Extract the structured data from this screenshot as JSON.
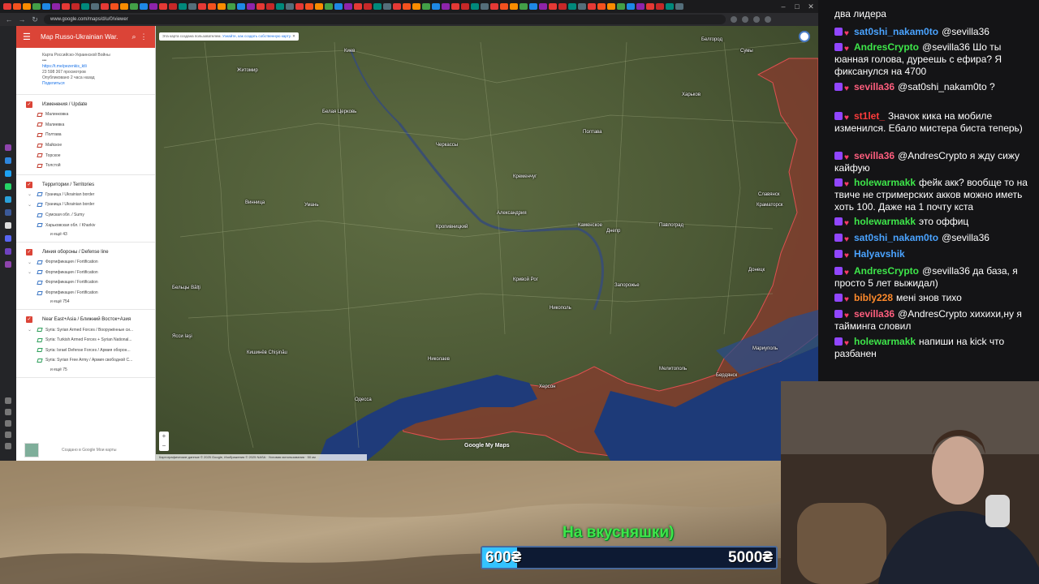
{
  "browser": {
    "url": "www.google.com/maps/d/u/0/viewer"
  },
  "map_panel": {
    "title": "Map Russo-Ukrainian War.",
    "info": {
      "line1": "Карта Российско-Украинской Войны",
      "link": "https://t.me/pezenkis_ktli",
      "views": "23 598 367 просмотров",
      "updated": "Опубликовано 2 часа назад",
      "share": "Поделиться"
    },
    "layers": [
      {
        "name": "Изменения / Update",
        "items": [
          "Малинковка",
          "Малиевка",
          "Полтава",
          "Майское",
          "Торское",
          "Толстой"
        ],
        "more": ""
      },
      {
        "name": "Территории / Territories",
        "items": [
          "Граница / Ukrainian border",
          "Граница / Ukrainian border",
          "Сумская обл. / Sumy",
          "Харьковская обл. / Kharkiv"
        ],
        "more": "и ещё 43"
      },
      {
        "name": "Линия обороны / Defense line",
        "items": [
          "Фортификация / Fortification",
          "Фортификация / Fortification",
          "Фортификация / Fortification",
          "Фортификация / Fortification"
        ],
        "more": "и ещё 754"
      },
      {
        "name": "Near East+Asia / Ближний Восток+Азия",
        "items": [
          "Syria: Syrian Armed Forces / Вооружённые си...",
          "Syria: Turkish Armed Forces + Syrian National...",
          "Syria: Israel Defense Forces / Армия оборон...",
          "Syria: Syrian Free Army / Армия свободной С..."
        ],
        "more": "и ещё 75"
      }
    ],
    "footer": "Создано в Google Мои карты"
  },
  "map": {
    "banner_text": "Эта карта создана пользователем.",
    "banner_link": "Узнайте, как создать собственную карту.",
    "google_logo": "Google My Maps",
    "attribution": "Картографические данные © 2025 Google, Изображения © 2025 NASA · Условия использования · 50 км",
    "cities": [
      {
        "name": "Киев"
      },
      {
        "name": "Житомир"
      },
      {
        "name": "Белая Церковь"
      },
      {
        "name": "Черкассы"
      },
      {
        "name": "Полтава"
      },
      {
        "name": "Харьков"
      },
      {
        "name": "Белгород"
      },
      {
        "name": "Сумы"
      },
      {
        "name": "Кременчуг"
      },
      {
        "name": "Умань"
      },
      {
        "name": "Кропивницкий"
      },
      {
        "name": "Александрия"
      },
      {
        "name": "Днепр"
      },
      {
        "name": "Каменское"
      },
      {
        "name": "Павлоград"
      },
      {
        "name": "Кривой Рог"
      },
      {
        "name": "Запорожье"
      },
      {
        "name": "Никополь"
      },
      {
        "name": "Николаев"
      },
      {
        "name": "Одесса"
      },
      {
        "name": "Кишинёв Chişinău"
      },
      {
        "name": "Бельцы Bălţi"
      },
      {
        "name": "Донецк"
      },
      {
        "name": "Краматорск"
      },
      {
        "name": "Мариуполь"
      },
      {
        "name": "Бердянск"
      },
      {
        "name": "Мелитополь"
      },
      {
        "name": "Херсон"
      },
      {
        "name": "Славянск"
      },
      {
        "name": "Винница"
      },
      {
        "name": "Ясси Iaşi"
      }
    ]
  },
  "chat": {
    "top_line": "два лидера",
    "messages": [
      {
        "user": "sat0shi_nakam0to",
        "color": "#4aa3ff",
        "text": "@sevilla36"
      },
      {
        "user": "AndresCrypto",
        "color": "#3ee64a",
        "text": "@sevilla36 Шо ты юанная голова, дуреешь с ефира? Я фиксанулся на 4700"
      },
      {
        "user": "sevilla36",
        "color": "#ff5e7e",
        "text": "@sat0shi_nakam0to ?"
      },
      {
        "user": "st1let_",
        "color": "#ff3b3b",
        "text": "Значок кика на мобиле изменился. Ебало мистера биста теперь)"
      },
      {
        "user": "sevilla36",
        "color": "#ff5e7e",
        "text": "@AndresCrypto я жду сижу кайфую"
      },
      {
        "user": "holewarmakk",
        "color": "#3ee64a",
        "text": "фейк акк? вообще то на твиче не стримерских акков можно иметь хоть 100. Даже на 1 почту кста"
      },
      {
        "user": "holewarmakk",
        "color": "#3ee64a",
        "text": "это оффиц"
      },
      {
        "user": "sat0shi_nakam0to",
        "color": "#4aa3ff",
        "text": "@sevilla36"
      },
      {
        "user": "Halyavshik",
        "color": "#4aa3ff",
        "text": ""
      },
      {
        "user": "AndresCrypto",
        "color": "#3ee64a",
        "text": "@sevilla36 да база, я просто 5 лет выжидал)"
      },
      {
        "user": "bibly228",
        "color": "#ff8a2b",
        "text": "мені знов тихо"
      },
      {
        "user": "sevilla36",
        "color": "#ff5e7e",
        "text": "@AndresCrypto хихихи,ну я тайминга словил"
      },
      {
        "user": "holewarmakk",
        "color": "#3ee64a",
        "text": "напиши на kick что разбанен"
      }
    ]
  },
  "donation": {
    "label": "На вкусняшки)",
    "current": "600₴",
    "goal": "5000₴",
    "progress": 0.12
  }
}
